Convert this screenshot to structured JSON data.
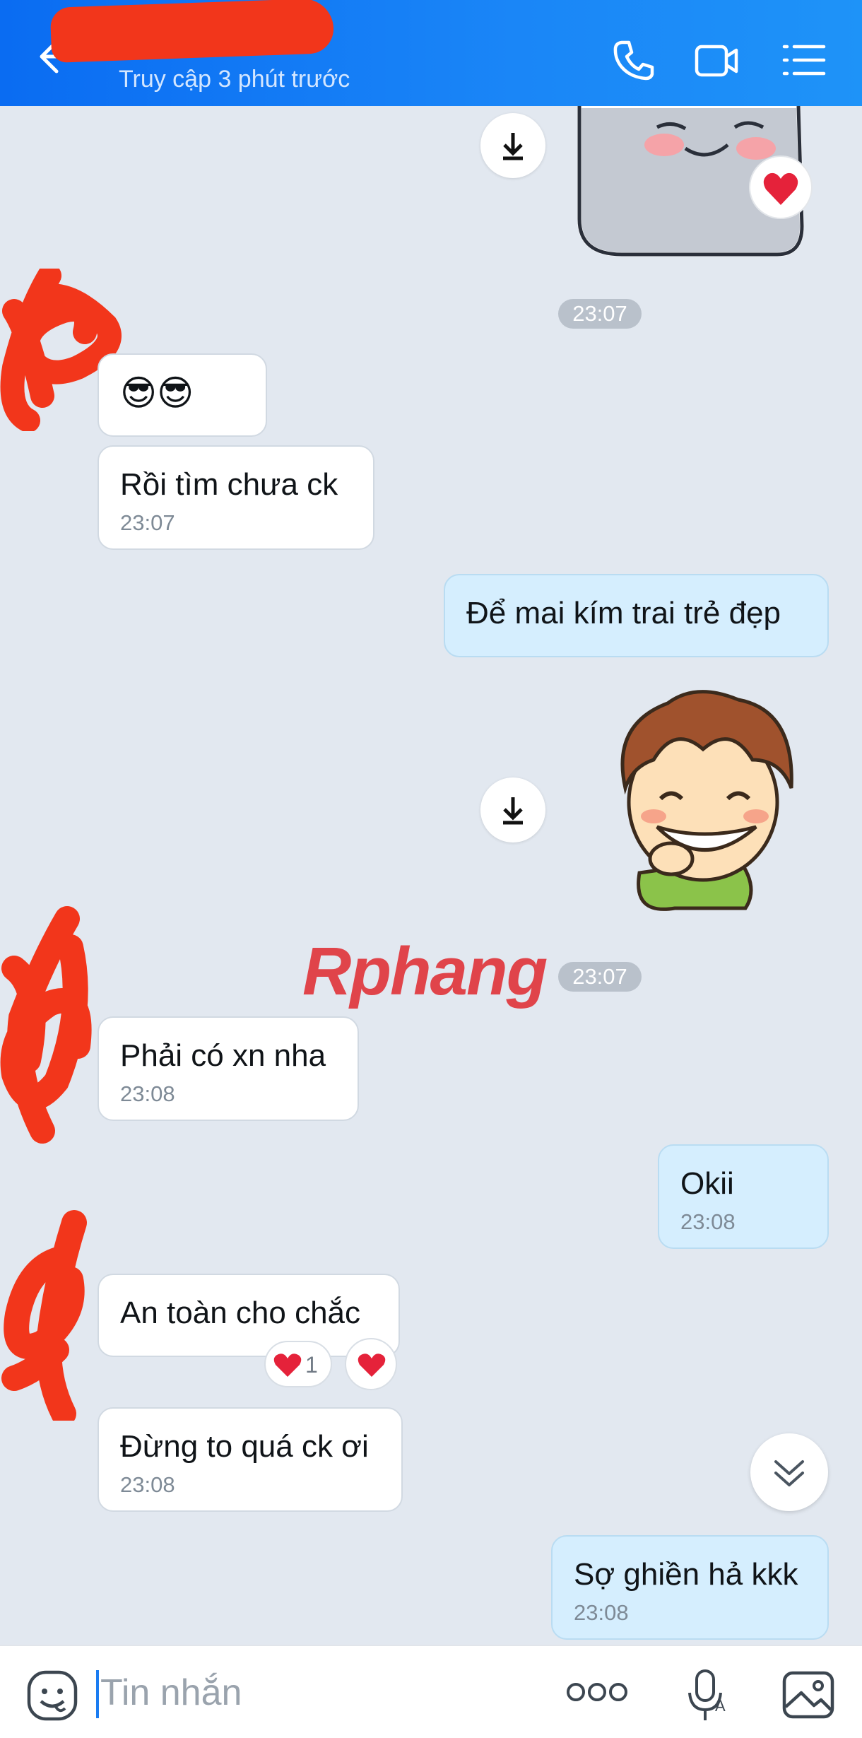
{
  "header": {
    "subtitle": "Truy cập 3 phút trước",
    "icons": [
      "back-arrow-icon",
      "phone-icon",
      "video-call-icon",
      "menu-list-icon"
    ]
  },
  "messages": {
    "time_pill_1": "23:07",
    "emoji_msg": "😎😎",
    "m1_text": "Rồi tìm chưa ck",
    "m1_time": "23:07",
    "m2_text": "Để mai kím trai trẻ đẹp",
    "time_pill_2": "23:07",
    "m3_text": "Phải có xn nha",
    "m3_time": "23:08",
    "m4_text": "Okii",
    "m4_time": "23:08",
    "m5_text": "An toàn cho chắc",
    "m5_reaction_count": "1",
    "m6_text": "Đừng to quá ck ơi",
    "m6_time": "23:08",
    "m7_text": "Sợ ghiền hả kkk",
    "m7_time": "23:08"
  },
  "watermark": "Rphang",
  "input": {
    "placeholder": "Tin nhắn"
  },
  "colors": {
    "header": "#1a86f7",
    "incoming": "#ffffff",
    "outgoing": "#d5eefe",
    "background": "#e2e8f0"
  }
}
